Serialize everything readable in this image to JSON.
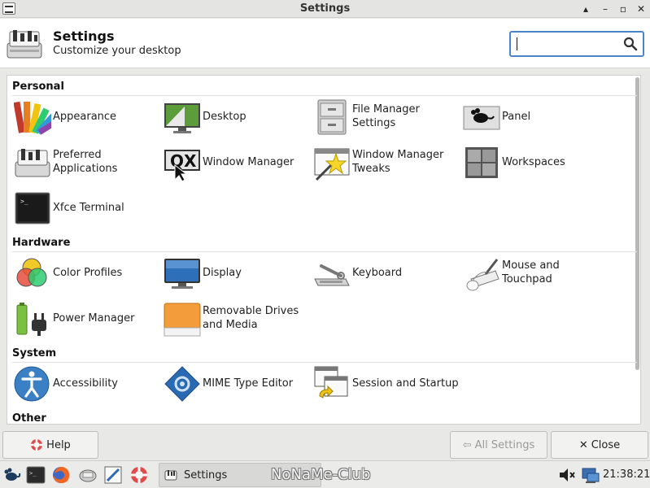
{
  "window": {
    "title": "Settings",
    "controls": [
      "▴",
      "–",
      "▫",
      "✕"
    ]
  },
  "header": {
    "title": "Settings",
    "subtitle": "Customize your desktop",
    "search_value": ""
  },
  "sections": {
    "personal": {
      "title": "Personal",
      "items": [
        {
          "label": "Appearance",
          "icon": "appearance-icon"
        },
        {
          "label": "Desktop",
          "icon": "desktop-icon"
        },
        {
          "label": "File Manager Settings",
          "icon": "file-manager-icon"
        },
        {
          "label": "Panel",
          "icon": "panel-icon"
        },
        {
          "label": "Preferred Applications",
          "icon": "preferred-apps-icon"
        },
        {
          "label": "Window Manager",
          "icon": "window-manager-icon"
        },
        {
          "label": "Window Manager Tweaks",
          "icon": "wm-tweaks-icon"
        },
        {
          "label": "Workspaces",
          "icon": "workspaces-icon"
        },
        {
          "label": "Xfce Terminal",
          "icon": "terminal-icon"
        }
      ]
    },
    "hardware": {
      "title": "Hardware",
      "items": [
        {
          "label": "Color Profiles",
          "icon": "color-profiles-icon"
        },
        {
          "label": "Display",
          "icon": "display-icon"
        },
        {
          "label": "Keyboard",
          "icon": "keyboard-icon"
        },
        {
          "label": "Mouse and Touchpad",
          "icon": "mouse-icon"
        },
        {
          "label": "Power Manager",
          "icon": "power-manager-icon"
        },
        {
          "label": "Removable Drives and Media",
          "icon": "removable-drives-icon"
        }
      ]
    },
    "system": {
      "title": "System",
      "items": [
        {
          "label": "Accessibility",
          "icon": "accessibility-icon"
        },
        {
          "label": "MIME Type Editor",
          "icon": "mime-editor-icon"
        },
        {
          "label": "Session and Startup",
          "icon": "session-startup-icon"
        }
      ]
    },
    "other": {
      "title": "Other"
    }
  },
  "buttons": {
    "help": "Help",
    "all_settings": "All Settings",
    "close": "Close"
  },
  "taskbar": {
    "active_task": "Settings",
    "watermark": "NoNaMe-Club",
    "clock": "21:38:21"
  }
}
